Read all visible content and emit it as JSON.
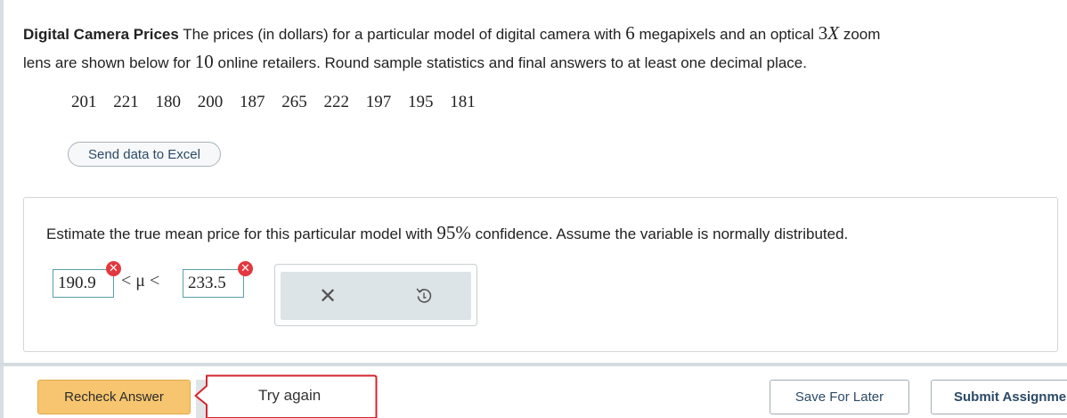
{
  "problem": {
    "title": "Digital Camera Prices",
    "text_1": "The prices (in dollars) for a particular model of digital camera with",
    "megapixels": "6",
    "text_2": "megapixels and an optical",
    "zoom_num": "3",
    "zoom_var": "X",
    "text_3": "zoom",
    "text_4": "lens are shown below for",
    "retailers": "10",
    "text_5": "online retailers. Round sample statistics and final answers to at least one decimal place."
  },
  "data_values": [
    "201",
    "221",
    "180",
    "200",
    "187",
    "265",
    "222",
    "197",
    "195",
    "181"
  ],
  "excel_button": "Send data to Excel",
  "question": {
    "text_1": "Estimate the true mean price for this particular model with",
    "confidence": "95%",
    "text_2": "confidence. Assume the variable is normally distributed."
  },
  "answer": {
    "lower": "190.9",
    "upper": "233.5",
    "middle": "< μ <",
    "error_symbol": "✕"
  },
  "tools": {
    "clear_symbol": "✕"
  },
  "footer": {
    "recheck": "Recheck Answer",
    "feedback": "Try again",
    "save": "Save For Later",
    "submit": "Submit Assignme"
  },
  "colors": {
    "error": "#e3383f",
    "accent_button": "#f7c56f",
    "input_border": "#5a9fa8"
  }
}
